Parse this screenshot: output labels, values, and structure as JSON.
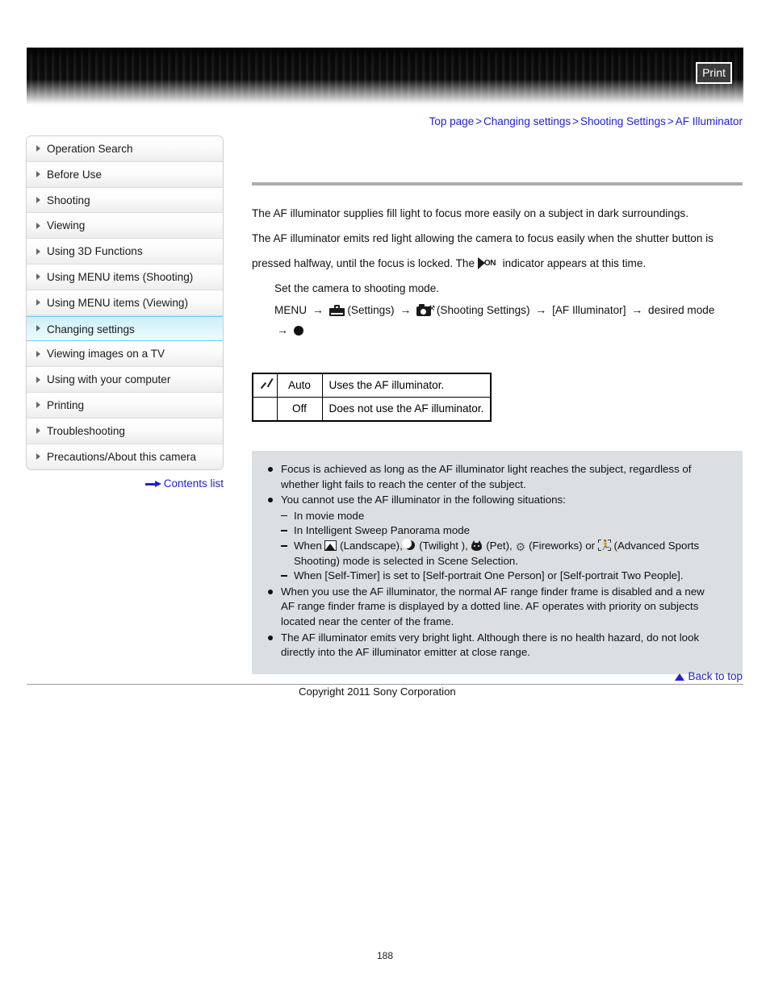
{
  "header": {
    "print_label": "Print"
  },
  "breadcrumb": {
    "items": [
      "Top page",
      "Changing settings",
      "Shooting Settings",
      "AF Illuminator"
    ],
    "separator": ">"
  },
  "sidebar": {
    "items": [
      {
        "label": "Operation Search",
        "active": false
      },
      {
        "label": "Before Use",
        "active": false
      },
      {
        "label": "Shooting",
        "active": false
      },
      {
        "label": "Viewing",
        "active": false
      },
      {
        "label": "Using 3D Functions",
        "active": false
      },
      {
        "label": "Using MENU items (Shooting)",
        "active": false
      },
      {
        "label": "Using MENU items (Viewing)",
        "active": false
      },
      {
        "label": "Changing settings",
        "active": true
      },
      {
        "label": "Viewing images on a TV",
        "active": false
      },
      {
        "label": "Using with your computer",
        "active": false
      },
      {
        "label": "Printing",
        "active": false
      },
      {
        "label": "Troubleshooting",
        "active": false
      },
      {
        "label": "Precautions/About this camera",
        "active": false
      }
    ],
    "contents_list_label": "Contents list"
  },
  "main": {
    "intro_line_1": "The AF illuminator supplies fill light to focus more easily on a subject in dark surroundings.",
    "intro_line_2": "The AF illuminator emits red light allowing the camera to focus easily when the shutter button is",
    "intro_line_3_before": "pressed halfway, until the focus is locked. The",
    "indicator_icon_text": "ON",
    "intro_line_3_after": "indicator appears at this time.",
    "step_line": "Set the camera to shooting mode.",
    "menu_path": {
      "menu_label": "MENU",
      "settings_label": "(Settings)",
      "shooting_settings_label": "(Shooting Settings)",
      "item_label": "[AF Illuminator]",
      "desired_mode_label": "desired mode",
      "arrow": "→"
    }
  },
  "options_table": {
    "rows": [
      {
        "selected": true,
        "name": "Auto",
        "description": "Uses the AF illuminator."
      },
      {
        "selected": false,
        "name": "Off",
        "description": "Does not use the AF illuminator."
      }
    ]
  },
  "notes": {
    "note_1_line_1": "Focus is achieved as long as the AF illuminator light reaches the subject, regardless of",
    "note_1_line_2": "whether light fails to reach the center of the subject.",
    "note_2_intro": "You cannot use the AF illuminator in the following situations:",
    "sub_1": "In movie mode",
    "sub_2": "In Intelligent Sweep Panorama mode",
    "sub_3_a": "When",
    "sub_3_landscape": "(Landscape),",
    "sub_3_twilight": "(Twilight ),",
    "sub_3_pet": "(Pet),",
    "sub_3_fireworks": "(Fireworks) or",
    "sub_3_sports": "(Advanced Sports",
    "sub_3_line2": "Shooting) mode is selected in Scene Selection.",
    "sub_4": "When [Self-Timer] is set to [Self-portrait One Person] or [Self-portrait Two People].",
    "note_3_line_1": "When you use the AF illuminator, the normal AF range finder frame is disabled and a new",
    "note_3_line_2": "AF range finder frame is displayed by a dotted line. AF operates with priority on subjects",
    "note_3_line_3": "located near the center of the frame.",
    "note_4_line_1": "The AF illuminator emits very bright light. Although there is no health hazard, do not look",
    "note_4_line_2": "directly into the AF illuminator emitter at close range."
  },
  "footer": {
    "back_to_top_label": "Back to top",
    "copyright": "Copyright 2011 Sony Corporation",
    "page_number": "188"
  },
  "colors": {
    "link_blue": "#2222cc",
    "active_sidebar": "#c9f0f8",
    "notes_bg": "#dcdfe2"
  }
}
